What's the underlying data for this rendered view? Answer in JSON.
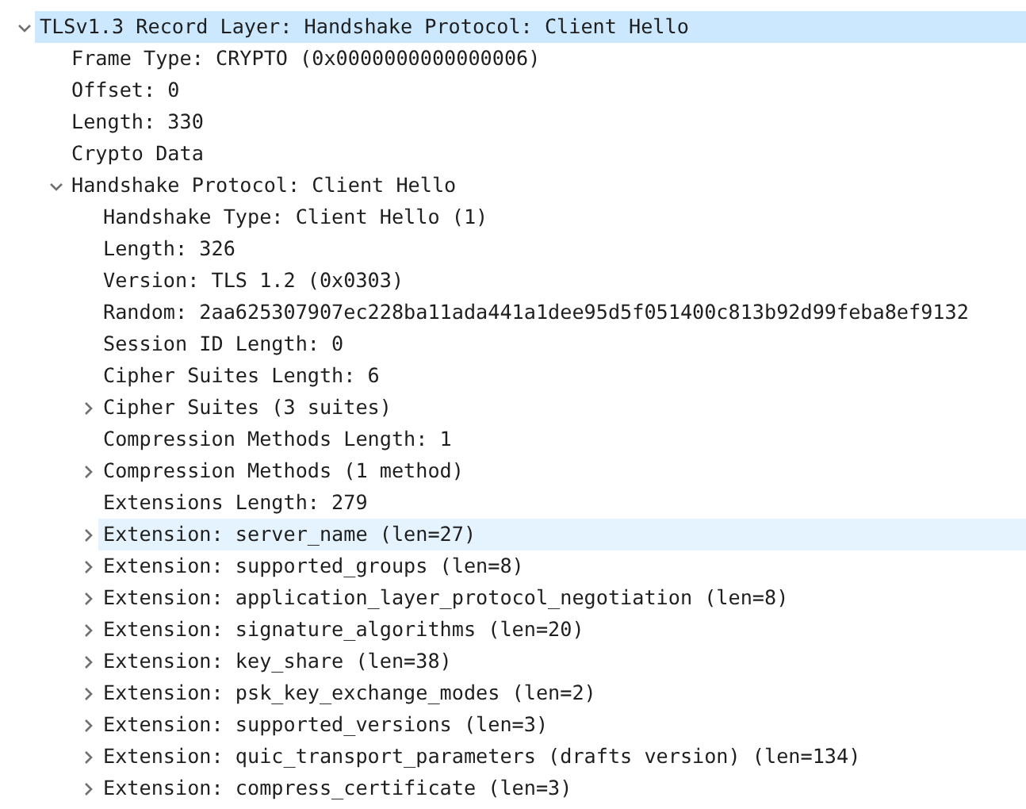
{
  "tree": [
    {
      "label": "TLSv1.3 Record Layer: Handshake Protocol: Client Hello",
      "expanded": true,
      "selected": true,
      "hovered": false,
      "children": [
        {
          "label": "Frame Type: CRYPTO (0x0000000000000006)",
          "selected": false,
          "hovered": false
        },
        {
          "label": "Offset: 0",
          "selected": false,
          "hovered": false
        },
        {
          "label": "Length: 330",
          "selected": false,
          "hovered": false
        },
        {
          "label": "Crypto Data",
          "selected": false,
          "hovered": false
        },
        {
          "label": "Handshake Protocol: Client Hello",
          "expanded": true,
          "selected": false,
          "hovered": false,
          "children": [
            {
              "label": "Handshake Type: Client Hello (1)",
              "selected": false,
              "hovered": false
            },
            {
              "label": "Length: 326",
              "selected": false,
              "hovered": false
            },
            {
              "label": "Version: TLS 1.2 (0x0303)",
              "selected": false,
              "hovered": false
            },
            {
              "label": "Random: 2aa625307907ec228ba11ada441a1dee95d5f051400c813b92d99feba8ef9132",
              "selected": false,
              "hovered": false
            },
            {
              "label": "Session ID Length: 0",
              "selected": false,
              "hovered": false
            },
            {
              "label": "Cipher Suites Length: 6",
              "selected": false,
              "hovered": false
            },
            {
              "label": "Cipher Suites (3 suites)",
              "expanded": false,
              "selected": false,
              "hovered": false
            },
            {
              "label": "Compression Methods Length: 1",
              "selected": false,
              "hovered": false
            },
            {
              "label": "Compression Methods (1 method)",
              "expanded": false,
              "selected": false,
              "hovered": false
            },
            {
              "label": "Extensions Length: 279",
              "selected": false,
              "hovered": false
            },
            {
              "label": "Extension: server_name (len=27)",
              "expanded": false,
              "selected": false,
              "hovered": true
            },
            {
              "label": "Extension: supported_groups (len=8)",
              "expanded": false,
              "selected": false,
              "hovered": false
            },
            {
              "label": "Extension: application_layer_protocol_negotiation (len=8)",
              "expanded": false,
              "selected": false,
              "hovered": false
            },
            {
              "label": "Extension: signature_algorithms (len=20)",
              "expanded": false,
              "selected": false,
              "hovered": false
            },
            {
              "label": "Extension: key_share (len=38)",
              "expanded": false,
              "selected": false,
              "hovered": false
            },
            {
              "label": "Extension: psk_key_exchange_modes (len=2)",
              "expanded": false,
              "selected": false,
              "hovered": false
            },
            {
              "label": "Extension: supported_versions (len=3)",
              "expanded": false,
              "selected": false,
              "hovered": false
            },
            {
              "label": "Extension: quic_transport_parameters (drafts version) (len=134)",
              "expanded": false,
              "selected": false,
              "hovered": false
            },
            {
              "label": "Extension: compress_certificate (len=3)",
              "expanded": false,
              "selected": false,
              "hovered": false
            }
          ]
        }
      ]
    }
  ]
}
